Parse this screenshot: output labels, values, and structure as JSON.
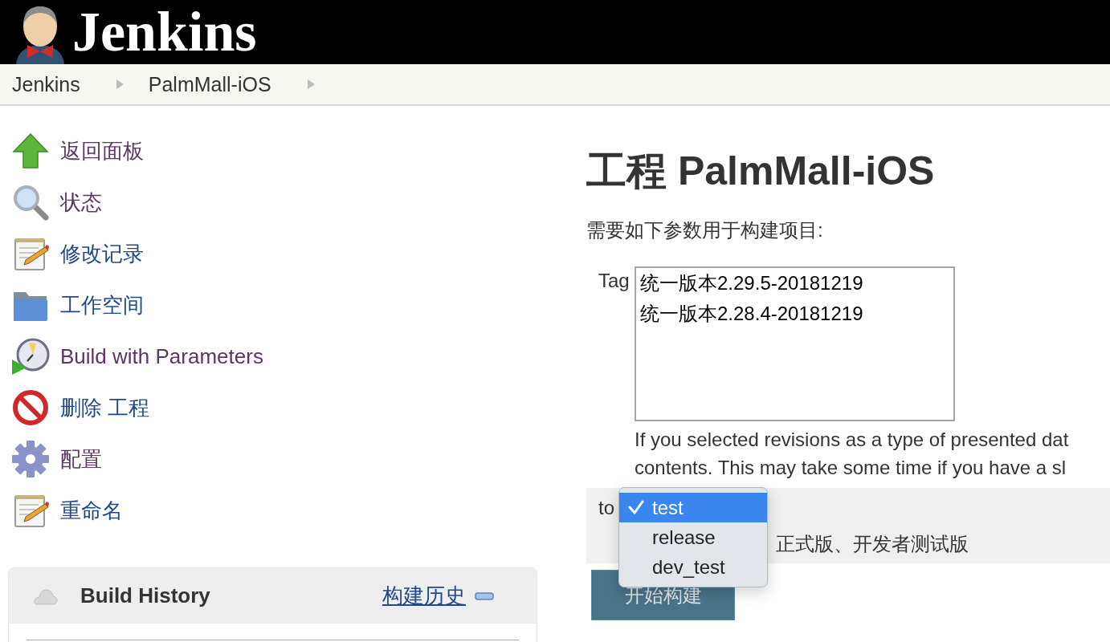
{
  "header": {
    "title": "Jenkins"
  },
  "breadcrumbs": [
    {
      "label": "Jenkins"
    },
    {
      "label": "PalmMall-iOS"
    }
  ],
  "sidebar": {
    "items": [
      {
        "kind": "back",
        "label": "返回面板",
        "visited": true
      },
      {
        "kind": "status",
        "label": "状态",
        "visited": true
      },
      {
        "kind": "changes",
        "label": "修改记录",
        "visited": false
      },
      {
        "kind": "workspace",
        "label": "工作空间",
        "visited": false
      },
      {
        "kind": "build",
        "label": "Build with Parameters",
        "visited": true
      },
      {
        "kind": "delete",
        "label": "删除 工程",
        "visited": false
      },
      {
        "kind": "configure",
        "label": "配置",
        "visited": true
      },
      {
        "kind": "rename",
        "label": "重命名",
        "visited": false
      }
    ],
    "build_history": {
      "title": "Build History",
      "link": "构建历史"
    }
  },
  "main": {
    "title": "工程 PalmMall-iOS",
    "intro": "需要如下参数用于构建项目:",
    "parameters": [
      {
        "kind": "listbox",
        "label": "Tag",
        "options": [
          {
            "label": "统一版本2.29.5-20181219",
            "selected": false
          },
          {
            "label": "统一版本2.28.4-20181219",
            "selected": false
          }
        ],
        "description_lines": [
          "If you selected revisions as a type of presented dat",
          "contents. This may take some time if you have a sl"
        ]
      },
      {
        "kind": "dropdown",
        "label": "to",
        "open": true,
        "options": [
          {
            "label": "test",
            "selected": true
          },
          {
            "label": "release",
            "selected": false
          },
          {
            "label": "dev_test",
            "selected": false
          }
        ],
        "description": "正式版、开发者测试版"
      }
    ],
    "submit": "开始构建"
  }
}
